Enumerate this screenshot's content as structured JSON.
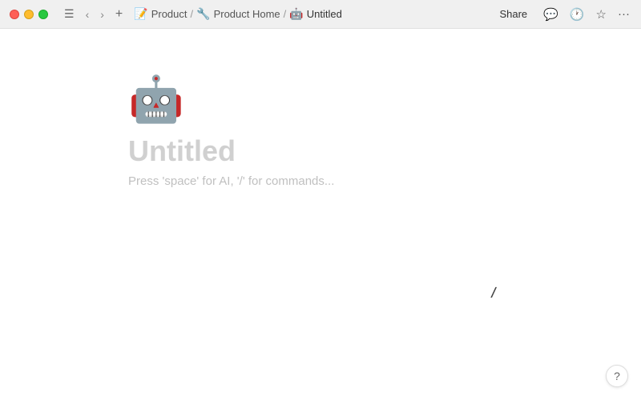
{
  "titlebar": {
    "traffic_lights": [
      "red",
      "yellow",
      "green"
    ],
    "nav_back": "‹",
    "nav_forward": "›",
    "add_label": "+",
    "breadcrumb": {
      "icon1": "📝",
      "item1": "Product",
      "sep1": "/",
      "icon2": "🔧",
      "item2": "Product Home",
      "sep2": "/",
      "icon3": "🤖",
      "item3": "Untitled"
    },
    "share_label": "Share",
    "icons": {
      "comment": "💬",
      "clock": "🕐",
      "star": "☆",
      "more": "···"
    }
  },
  "page": {
    "icon": "🤖",
    "title": "Untitled",
    "placeholder": "Press 'space' for AI, '/' for commands..."
  },
  "help": {
    "label": "?"
  }
}
